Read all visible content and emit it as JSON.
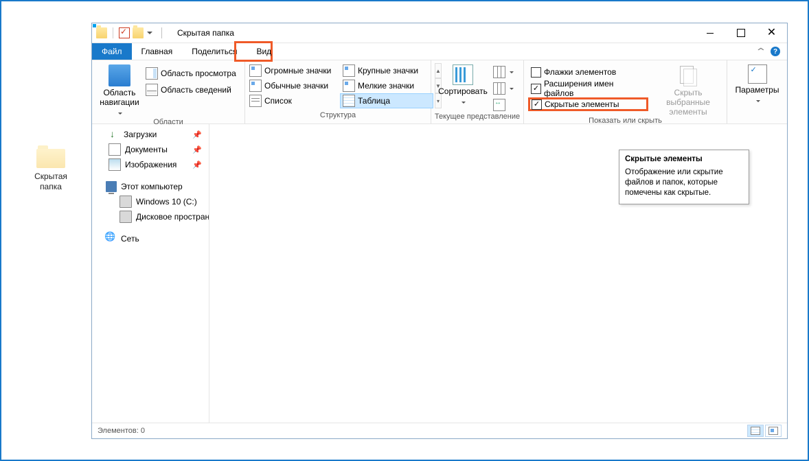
{
  "desktop": {
    "icon_label": "Скрытая\nпапка"
  },
  "titlebar": {
    "title": "Скрытая папка"
  },
  "tabs": {
    "file": "Файл",
    "home": "Главная",
    "share": "Поделиться",
    "view": "Вид"
  },
  "ribbon": {
    "panes": {
      "caption": "Области",
      "nav_pane": "Область\nнавигации",
      "preview_pane": "Область просмотра",
      "details_pane": "Область сведений"
    },
    "layout": {
      "caption": "Структура",
      "huge_icons": "Огромные значки",
      "large_icons": "Крупные значки",
      "medium_icons": "Обычные значки",
      "small_icons": "Мелкие значки",
      "list": "Список",
      "table": "Таблица"
    },
    "current_view": {
      "caption": "Текущее представление",
      "sort": "Сортировать"
    },
    "show_hide": {
      "caption": "Показать или скрыть",
      "item_checkboxes": "Флажки элементов",
      "file_ext": "Расширения имен файлов",
      "hidden_items": "Скрытые элементы",
      "hide_selected": "Скрыть выбранные\nэлементы"
    },
    "options": {
      "caption": "",
      "label": "Параметры"
    }
  },
  "tree": {
    "downloads": "Загрузки",
    "documents": "Документы",
    "pictures": "Изображения",
    "this_pc": "Этот компьютер",
    "c_drive": "Windows 10 (C:)",
    "d_drive": "Дисковое простран",
    "network": "Сеть"
  },
  "statusbar": {
    "items": "Элементов: 0"
  },
  "tooltip": {
    "title": "Скрытые элементы",
    "body": "Отображение или скрытие файлов и папок, которые помечены как скрытые."
  }
}
